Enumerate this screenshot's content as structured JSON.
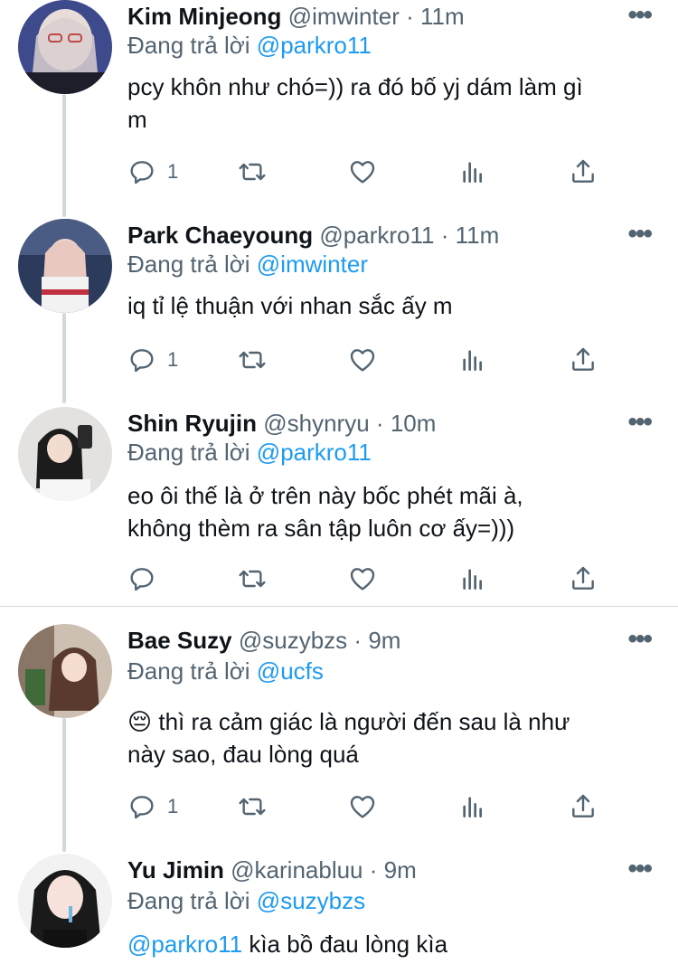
{
  "reply_label": "Đang trả lời",
  "tweets": [
    {
      "name": "Kim Minjeong",
      "handle": "@imwinter",
      "time": "11m",
      "reply_to": "@parkro11",
      "text_lines": [
        "pcy khôn như chó=)) ra đó bố yj dám làm gì",
        "m"
      ],
      "reply_count": "1",
      "avatar_color": "#c9c3cf"
    },
    {
      "name": "Park Chaeyoung",
      "handle": "@parkro11",
      "time": "11m",
      "reply_to": "@imwinter",
      "text_lines": [
        "iq tỉ lệ thuận với nhan sắc ấy m"
      ],
      "reply_count": "1",
      "avatar_color": "#3a4a6b"
    },
    {
      "name": "Shin Ryujin",
      "handle": "@shynryu",
      "time": "10m",
      "reply_to": "@parkro11",
      "text_lines": [
        "eo ôi thế là ở trên này bốc phét mãi à,",
        "không thèm ra sân tập luôn cơ ấy=)))"
      ],
      "reply_count": "",
      "avatar_color": "#d8d6d4"
    },
    {
      "name": "Bae Suzy",
      "handle": "@suzybzs",
      "time": "9m",
      "reply_to": "@ucfs",
      "emoji": "😔",
      "text_lines": [
        "thì ra cảm giác là người đến sau là như",
        "này sao, đau lòng quá"
      ],
      "reply_count": "1",
      "avatar_color": "#b89a86"
    },
    {
      "name": "Yu Jimin",
      "handle": "@karinabluu",
      "time": "9m",
      "reply_to": "@suzybzs",
      "mention_in_text": "@parkro11",
      "text_lines": [
        "kìa bồ đau lòng kìa"
      ],
      "reply_count": "",
      "avatar_color": "#2b2b2b"
    }
  ],
  "icons": [
    "reply-icon",
    "retweet-icon",
    "like-icon",
    "analytics-icon",
    "share-icon",
    "more-icon"
  ],
  "colors": {
    "link": "#1d9bf0",
    "secondary": "#536471",
    "line": "#cfd9de"
  }
}
